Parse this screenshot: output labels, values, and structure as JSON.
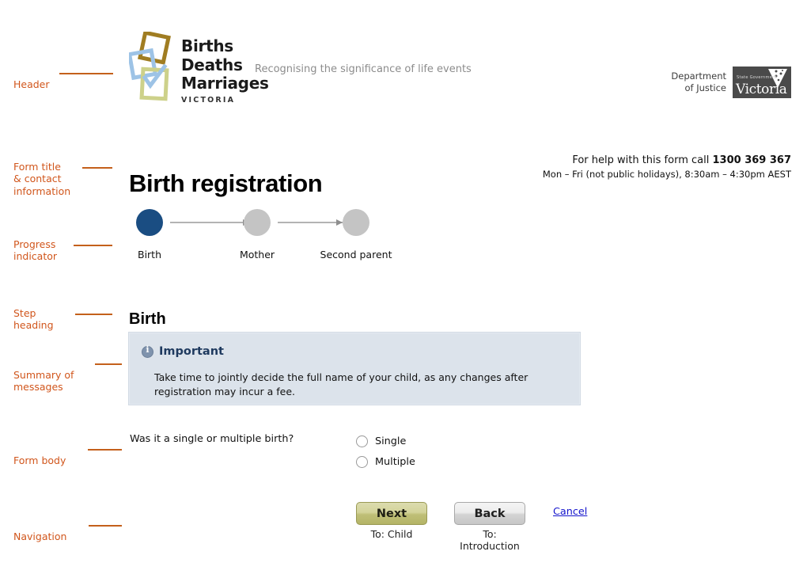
{
  "annotations": [
    {
      "label": "Header"
    },
    {
      "label": "Form title\n& contact\ninformation"
    },
    {
      "label": "Progress\nindicator"
    },
    {
      "label": "Step\nheading"
    },
    {
      "label": "Summary of\nmessages"
    },
    {
      "label": "Form body"
    },
    {
      "label": "Navigation"
    }
  ],
  "header": {
    "logo": {
      "line1": "Births",
      "line2": "Deaths",
      "line3": "Marriages",
      "state": "VICTORIA",
      "colors": {
        "gold": "#a07d22",
        "blue": "#9dc3e6",
        "olive": "#cdd18a"
      }
    },
    "tagline": "Recognising the significance of life events",
    "government": {
      "department_line1": "Department",
      "department_line2": "of Justice",
      "state_government": "State Government",
      "state_name": "Victoria",
      "box_color": "#4a4a4a"
    }
  },
  "form_title": "Birth registration",
  "contact": {
    "help_text": "For help with this form call ",
    "phone": "1300 369 367",
    "hours": "Mon – Fri (not public holidays), 8:30am – 4:30pm AEST"
  },
  "progress": {
    "active_color": "#1a4d82",
    "inactive_color": "#c4c4c4",
    "steps": [
      {
        "label": "Birth",
        "state": "active"
      },
      {
        "label": "Mother",
        "state": "inactive"
      },
      {
        "label": "Second parent",
        "state": "inactive"
      }
    ]
  },
  "step_heading": "Birth",
  "message": {
    "icon": "info-icon",
    "title": "Important",
    "body": "Take time to jointly decide the full name of your child, as any changes after registration may incur a fee.",
    "background": "#dce3eb",
    "title_color": "#1f3a5f"
  },
  "form_body": {
    "question": "Was it a single or multiple birth?",
    "options": [
      {
        "label": "Single",
        "selected": false
      },
      {
        "label": "Multiple",
        "selected": false
      }
    ]
  },
  "navigation": {
    "next_label": "Next",
    "next_sub": "To: Child",
    "back_label": "Back",
    "back_sub": "To: Introduction",
    "cancel_label": "Cancel",
    "next_color": "#bfbf78",
    "cancel_color": "#1414cc"
  }
}
